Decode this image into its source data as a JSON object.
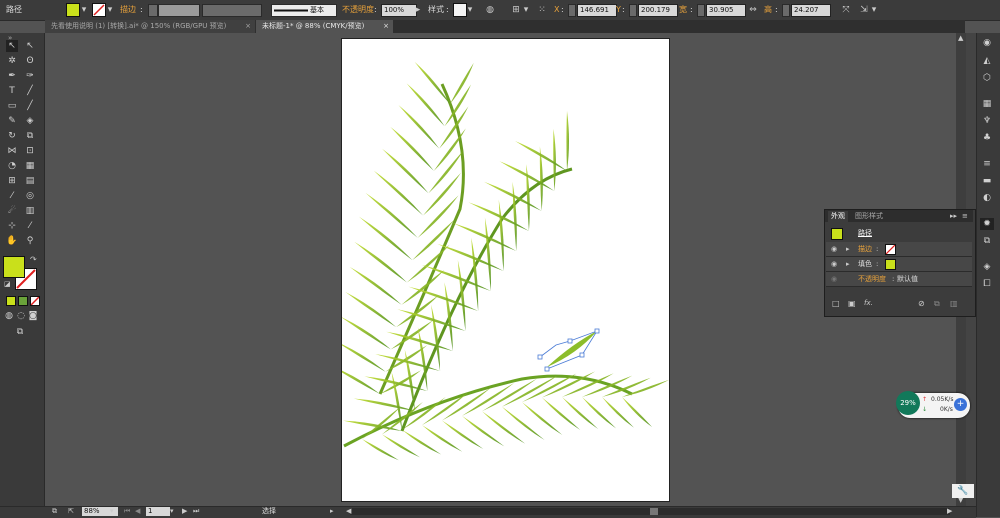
{
  "control_bar": {
    "object_type": "路径",
    "stroke_label": "描边",
    "brush_label": "基本",
    "opacity_label": "不透明度",
    "opacity_value": "100%",
    "style_label": "样式",
    "x_label": "X",
    "x_value": "146.691",
    "y_label": "Y",
    "y_value": "200.179",
    "w_label": "宽",
    "w_value": "30.905",
    "h_label": "高",
    "h_value": "24.207",
    "fill_color": "#c9e01b",
    "accent_color": "#e8a23b"
  },
  "tabs": [
    {
      "label": "先看使用说明 (1) [转换].ai* @ 150% (RGB/GPU 预览)",
      "close": "×"
    },
    {
      "label": "未标题-1* @ 88% (CMYK/预览)",
      "close": "×"
    }
  ],
  "panel": {
    "tab_appearance": "外观",
    "tab_graphic_styles": "图形样式",
    "object_name": "路径",
    "stroke_label": "描边",
    "fill_label": "填色",
    "opacity_label": "不透明度",
    "opacity_value": "默认值",
    "fx_label": "fx."
  },
  "status": {
    "zoom": "88%",
    "artboard": "1",
    "tool": "选择"
  },
  "network_widget": {
    "percent": "29%",
    "upload": "0.05K/s",
    "download": "0K/s"
  },
  "icons": {
    "selection": "selection-tool-icon",
    "direct_selection": "direct-selection-tool-icon",
    "pen": "pen-tool-icon",
    "type": "type-tool-icon",
    "hand": "hand-tool-icon",
    "zoom": "zoom-tool-icon"
  }
}
